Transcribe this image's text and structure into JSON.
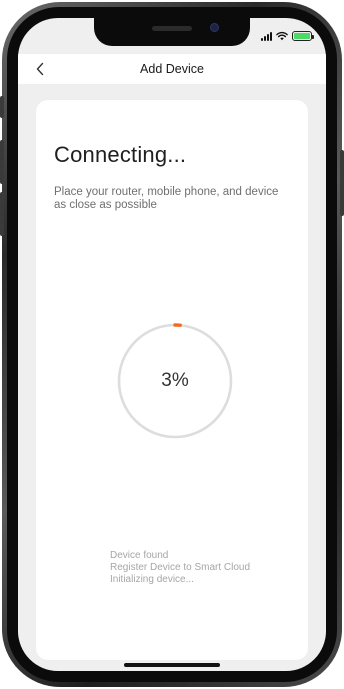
{
  "status_bar": {
    "icons": [
      "signal-icon",
      "wifi-icon",
      "battery-charging-icon"
    ],
    "battery_color": "#4cd964"
  },
  "nav": {
    "back_icon": "chevron-left-icon",
    "title": "Add Device"
  },
  "connecting": {
    "heading": "Connecting...",
    "description": "Place your router, mobile phone, and device as close as possible"
  },
  "progress": {
    "label": "3%",
    "value": 3,
    "accent_color": "#f26a21",
    "track_color": "#dddddd"
  },
  "steps": [
    "Device found",
    "Register Device to Smart Cloud",
    "Initializing device..."
  ]
}
